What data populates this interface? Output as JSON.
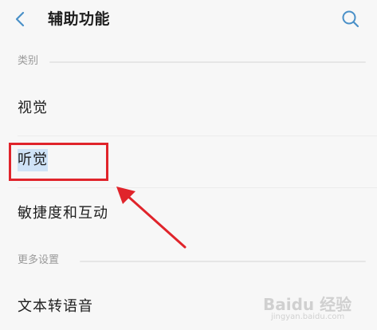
{
  "header": {
    "title": "辅助功能",
    "back_icon": "chevron-left-icon",
    "search_icon": "search-icon",
    "accent_color": "#4a90c8"
  },
  "sections": [
    {
      "label": "类别",
      "items": [
        {
          "label": "视觉"
        },
        {
          "label": "听觉"
        },
        {
          "label": "敏捷度和互动"
        }
      ]
    },
    {
      "label": "更多设置",
      "items": [
        {
          "label": "文本转语音"
        }
      ]
    }
  ],
  "annotation": {
    "highlight_color": "#e0242b",
    "highlighted_item": "听觉"
  },
  "watermark": {
    "text": "Baidu 经验",
    "sub": "jingyan.baidu.com"
  }
}
